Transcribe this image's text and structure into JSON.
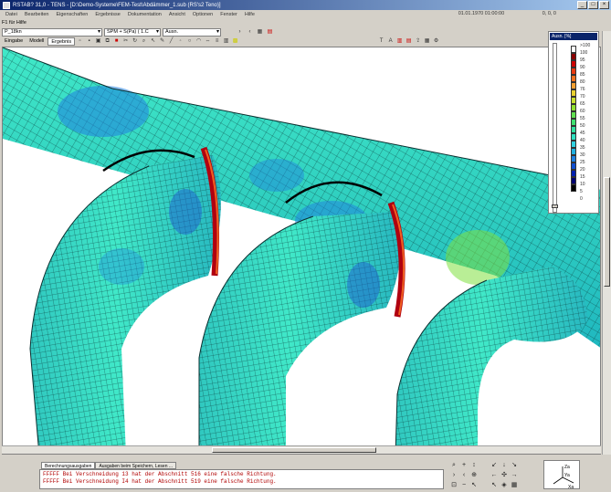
{
  "window": {
    "title": "RSTAB? 31,0 - TENS - [D:\\Demo-Systeme\\FEM-Test\\Abdämmer_1.sub (RS's2 Teno)]",
    "close": "×"
  },
  "menu": {
    "items": [
      "Datei",
      "Bearbeiten",
      "Eigenschaften",
      "Ergebnisse",
      "Dokumentation",
      "Ansicht",
      "Optionen",
      "Fenster",
      "Hilfe"
    ],
    "date": "01.01.1970 01:00:00",
    "coords": "0, 0, 0"
  },
  "hint": "F1 für Hilfe",
  "toolbar": {
    "lc_select": "P_18kn",
    "result_select": "SPM + S(Pa) ( 1.C",
    "comp_select": "Ausn."
  },
  "tabs": [
    "Eingabe",
    "Modell",
    "Ergebnis"
  ],
  "legend": {
    "title": "Ausn. [%]",
    "colors": [
      "#ffffff",
      "#8b0000",
      "#cc0000",
      "#e83a10",
      "#f07020",
      "#f5a030",
      "#e8d030",
      "#c8e030",
      "#90e030",
      "#60e050",
      "#40e070",
      "#30e0a0",
      "#30e0c0",
      "#30d0e0",
      "#20b0e0",
      "#1e80e0",
      "#1050d0",
      "#0020b0",
      "#000070",
      "#000000"
    ],
    "labels": [
      ">100",
      "100",
      "95",
      "90",
      "85",
      "80",
      "76",
      "70",
      "65",
      "60",
      "55",
      "50",
      "45",
      "40",
      "35",
      "30",
      "25",
      "20",
      "15",
      "10",
      "5",
      "0"
    ]
  },
  "bottom": {
    "tabs": [
      "Berechnungsausgaben",
      "Ausgaben beim Speichern, Lesen ..."
    ],
    "messages": [
      "FFFFF Bei Verschneidung 13 hat der Abschnitt 516 eine falsche Richtung.",
      "FFFFF Bei Verschneidung I4 hat der Abschnitt 519 eine falsche Richtung."
    ],
    "axes": {
      "x": "Xa",
      "y": "Ya",
      "z": "Za"
    }
  }
}
